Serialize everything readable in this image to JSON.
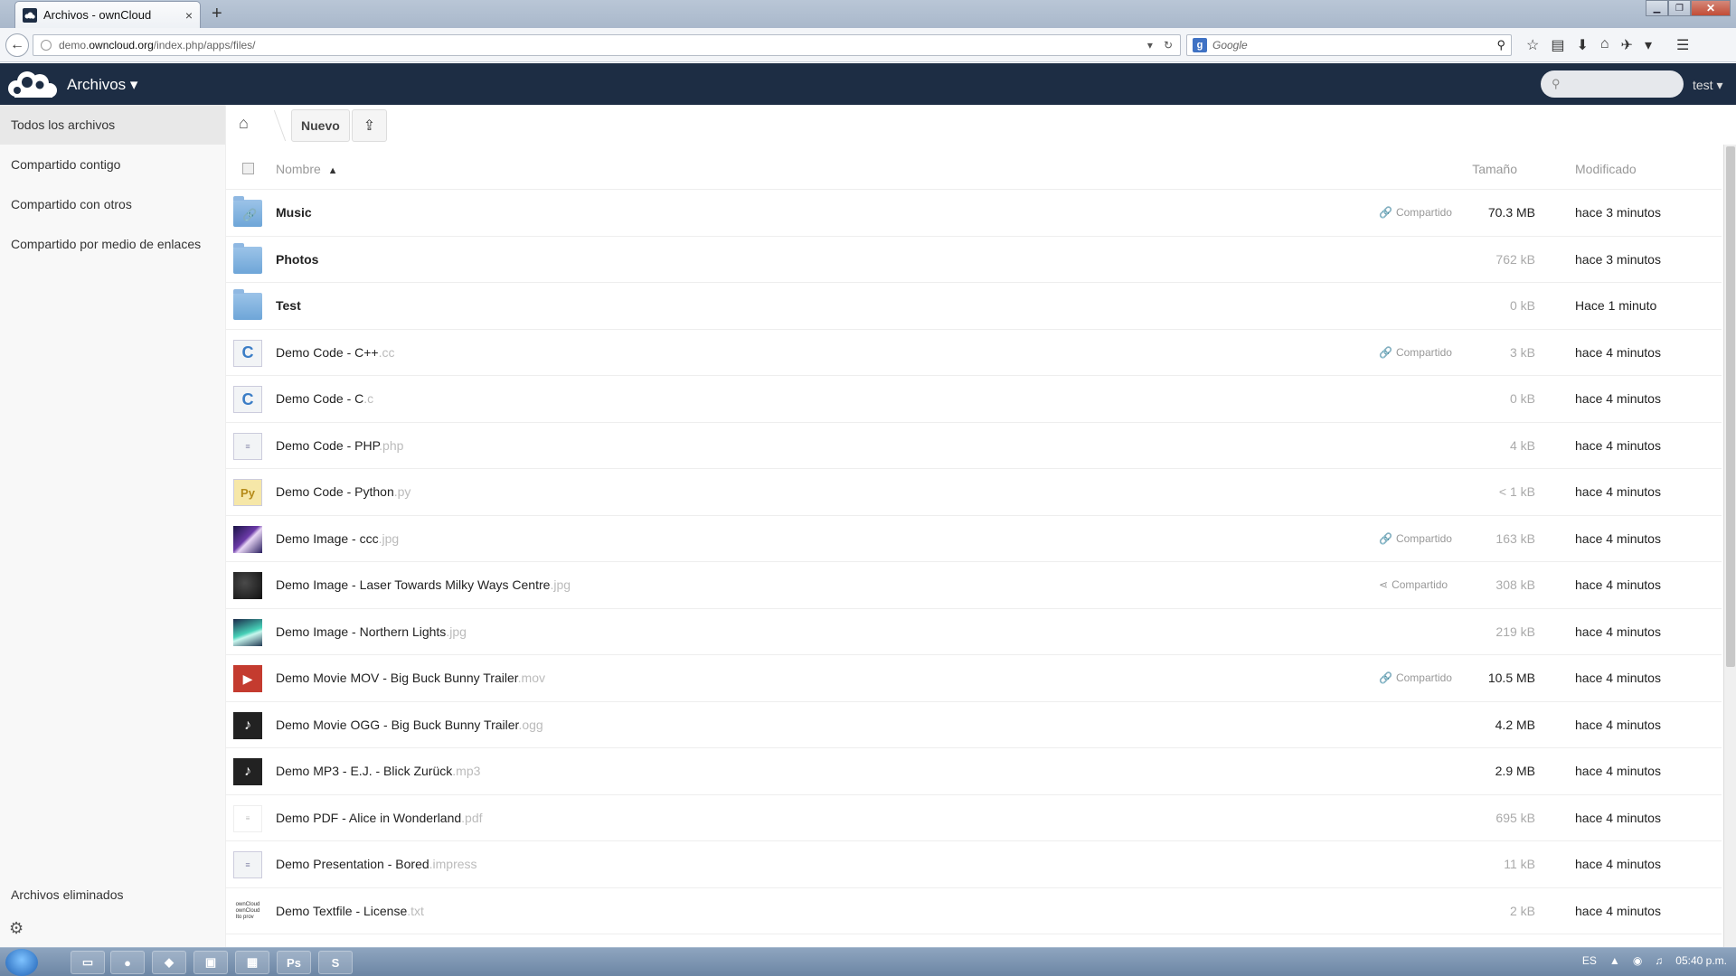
{
  "browser": {
    "tab_title": "Archivos - ownCloud",
    "tab_close": "×",
    "new_tab": "+",
    "url_host": "demo.owncloud.org",
    "url_path": "/index.php/apps/files/",
    "url_prefix": "demo.",
    "url_domain": "owncloud.org",
    "search_engine": "g",
    "search_placeholder": "Google"
  },
  "header": {
    "app_name": "Archivos ▾",
    "search_placeholder": "",
    "user": "test ▾",
    "background_color": "#1d2d44"
  },
  "sidebar": {
    "items": [
      {
        "label": "Todos los archivos",
        "active": true
      },
      {
        "label": "Compartido contigo"
      },
      {
        "label": "Compartido con otros"
      },
      {
        "label": "Compartido por medio de enlaces"
      }
    ],
    "trash_label": "Archivos eliminados"
  },
  "toolbar": {
    "new_label": "Nuevo"
  },
  "table": {
    "col_name": "Nombre",
    "sort_indicator": "▲",
    "col_size": "Tamaño",
    "col_modified": "Modificado",
    "shared_label": "Compartido",
    "rows": [
      {
        "name": "Music",
        "ext": "",
        "type": "folder-link",
        "shared": "link",
        "size": "70.3 MB",
        "modified": "hace 3 minutos"
      },
      {
        "name": "Photos",
        "ext": "",
        "type": "folder",
        "shared": "",
        "size": "762 kB",
        "modified": "hace 3 minutos"
      },
      {
        "name": "Test",
        "ext": "",
        "type": "folder",
        "shared": "",
        "size": "0 kB",
        "modified": "Hace 1 minuto"
      },
      {
        "name": "Demo Code - C++",
        "ext": ".cc",
        "type": "code-c",
        "shared": "link",
        "size": "3 kB",
        "modified": "hace 4 minutos"
      },
      {
        "name": "Demo Code - C",
        "ext": ".c",
        "type": "code-c",
        "shared": "",
        "size": "0 kB",
        "modified": "hace 4 minutos"
      },
      {
        "name": "Demo Code - PHP",
        "ext": ".php",
        "type": "text",
        "shared": "",
        "size": "4 kB",
        "modified": "hace 4 minutos"
      },
      {
        "name": "Demo Code - Python",
        "ext": ".py",
        "type": "python",
        "shared": "",
        "size": "< 1 kB",
        "modified": "hace 4 minutos"
      },
      {
        "name": "Demo Image - ccc",
        "ext": ".jpg",
        "type": "image-purple",
        "shared": "link",
        "size": "163 kB",
        "modified": "hace 4 minutos"
      },
      {
        "name": "Demo Image - Laser Towards Milky Ways Centre",
        "ext": ".jpg",
        "type": "image-dark",
        "shared": "share",
        "size": "308 kB",
        "modified": "hace 4 minutos"
      },
      {
        "name": "Demo Image - Northern Lights",
        "ext": ".jpg",
        "type": "image-green",
        "shared": "",
        "size": "219 kB",
        "modified": "hace 4 minutos"
      },
      {
        "name": "Demo Movie MOV - Big Buck Bunny Trailer",
        "ext": ".mov",
        "type": "movie",
        "shared": "link",
        "size": "10.5 MB",
        "modified": "hace 4 minutos"
      },
      {
        "name": "Demo Movie OGG - Big Buck Bunny Trailer",
        "ext": ".ogg",
        "type": "audio",
        "shared": "",
        "size": "4.2 MB",
        "modified": "hace 4 minutos"
      },
      {
        "name": "Demo MP3 - E.J. - Blick Zurück",
        "ext": ".mp3",
        "type": "audio",
        "shared": "",
        "size": "2.9 MB",
        "modified": "hace 4 minutos"
      },
      {
        "name": "Demo PDF - Alice in Wonderland",
        "ext": ".pdf",
        "type": "pdf",
        "shared": "",
        "size": "695 kB",
        "modified": "hace 4 minutos"
      },
      {
        "name": "Demo Presentation - Bored",
        "ext": ".impress",
        "type": "text",
        "shared": "",
        "size": "11 kB",
        "modified": "hace 4 minutos"
      },
      {
        "name": "Demo Textfile - License",
        "ext": ".txt",
        "type": "textfile",
        "shared": "",
        "size": "2 kB",
        "modified": "hace 4 minutos"
      }
    ]
  },
  "taskbar": {
    "language": "ES",
    "clock": "05:40 p.m."
  }
}
